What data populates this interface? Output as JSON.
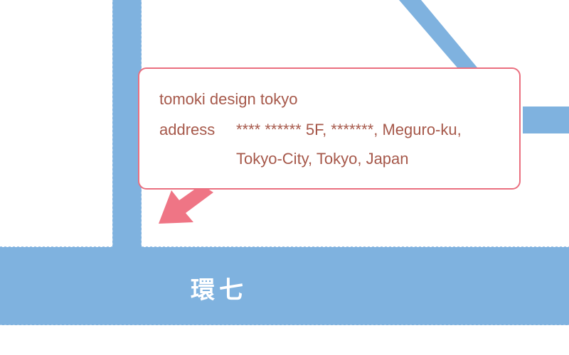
{
  "map": {
    "colors": {
      "road": "#7fb2df",
      "arrow": "#ef7585",
      "callout_border": "#ea6f7f",
      "callout_text": "#a6584a",
      "background": "#ffffff"
    },
    "roads": [
      {
        "name": "環七",
        "type": "major-road"
      },
      {
        "type": "vertical-street"
      },
      {
        "type": "diagonal-street"
      },
      {
        "type": "side-street"
      }
    ],
    "road_label": "環七"
  },
  "callout": {
    "company": "tomoki design tokyo",
    "address_label": "address",
    "address_lines": [
      "**** ****** 5F, *******, Meguro-ku,",
      "Tokyo-City, Tokyo, Japan"
    ]
  },
  "pointer": {
    "icon": "arrow-pointer-icon"
  }
}
